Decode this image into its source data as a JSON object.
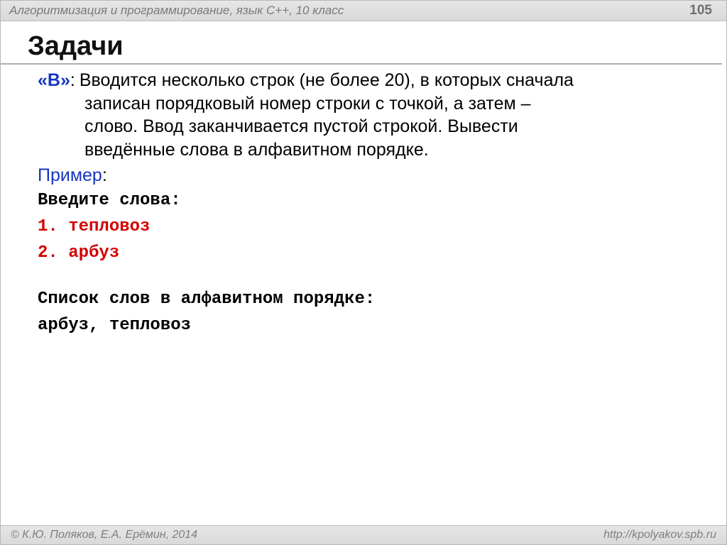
{
  "header": {
    "course": "Алгоритмизация и программирование, язык С++, 10 класс",
    "page": "105"
  },
  "title": "Задачи",
  "task": {
    "label": "«B»",
    "colon": ":",
    "line1": "Вводится несколько строк (не более 20), в которых сначала",
    "line2": "записан порядковый номер строки с точкой, а затем –",
    "line3": "слово. Ввод заканчивается пустой строкой. Вывести",
    "line4": "введённые слова в алфавитном порядке."
  },
  "example": {
    "label": "Пример",
    "colon": ":",
    "prompt": "Введите слова:",
    "input1": "1. тепловоз",
    "input2": "2. арбуз",
    "result_label": "Список слов в алфавитном порядке:",
    "result": "арбуз, тепловоз"
  },
  "footer": {
    "copyright": "© К.Ю. Поляков, Е.А. Ерёмин, 2014",
    "url": "http://kpolyakov.spb.ru"
  }
}
